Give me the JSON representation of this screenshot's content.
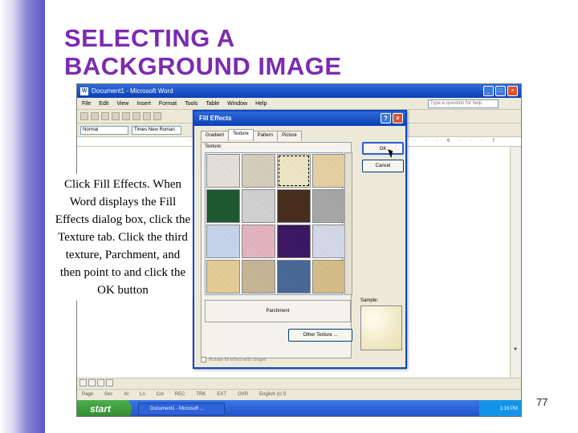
{
  "slide": {
    "title_line1": "SELECTING A",
    "title_line2": "BACKGROUND IMAGE",
    "instructions": "Click Fill Effects. When Word displays the Fill Effects dialog box, click the Texture tab.  Click the third texture, Parchment, and then point to and click the OK button",
    "slide_number": "77",
    "title_color": "#7b2bb0"
  },
  "word_window": {
    "title": "Document1 - Microsoft Word",
    "menu": [
      "File",
      "Edit",
      "View",
      "Insert",
      "Format",
      "Tools",
      "Table",
      "Window",
      "Help"
    ],
    "help_placeholder": "Type a question for help",
    "style_box": "Normal",
    "font_box": "Times New Roman",
    "status": [
      "Page",
      "Sec",
      "At",
      "Ln",
      "Col",
      "REC",
      "TRK",
      "EXT",
      "OVR",
      "English (U.S"
    ],
    "taskbar": {
      "start_label": "start",
      "task_item": "Document1 - Microsoft ...",
      "clock": "1:16 PM"
    }
  },
  "dialog": {
    "title": "Fill Effects",
    "tabs": [
      "Gradient",
      "Texture",
      "Pattern",
      "Picture"
    ],
    "active_tab": "Texture",
    "texture_label": "Texture:",
    "textures": [
      {
        "name": "Newsprint",
        "color": "#e6e4dc"
      },
      {
        "name": "Recycled paper",
        "color": "#d9d1c0"
      },
      {
        "name": "Parchment",
        "color": "#f1e9c8",
        "selected": true
      },
      {
        "name": "Stationery",
        "color": "#e9d3a6"
      },
      {
        "name": "Green marble",
        "color": "#1e5a32"
      },
      {
        "name": "White marble",
        "color": "#d4d4d4"
      },
      {
        "name": "Brown marble",
        "color": "#4a2e1e"
      },
      {
        "name": "Granite",
        "color": "#a9a9a9"
      },
      {
        "name": "Blue tissue paper",
        "color": "#c9d8ee"
      },
      {
        "name": "Pink tissue paper",
        "color": "#e6b7c2"
      },
      {
        "name": "Purple mesh",
        "color": "#3c1866"
      },
      {
        "name": "Bouquet",
        "color": "#d7dcec"
      },
      {
        "name": "Papyrus",
        "color": "#e7cf98"
      },
      {
        "name": "Canvas",
        "color": "#c8b898"
      },
      {
        "name": "Denim",
        "color": "#4a6a9a"
      },
      {
        "name": "Woven mat",
        "color": "#d9c08a"
      }
    ],
    "selected_texture_name": "Parchment",
    "other_texture_button": "Other Texture ...",
    "ok_button": "OK",
    "cancel_button": "Cancel",
    "sample_label": "Sample:",
    "rotate_checkbox": "Rotate fill effect with shape"
  }
}
